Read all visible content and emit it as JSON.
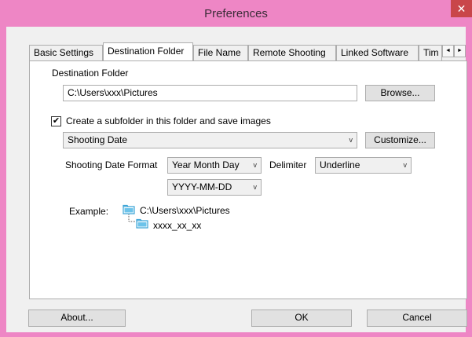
{
  "window": {
    "title": "Preferences",
    "close_icon": "close-icon",
    "close_glyph": "✕"
  },
  "tabs": [
    {
      "label": "Basic Settings",
      "active": false
    },
    {
      "label": "Destination Folder",
      "active": true
    },
    {
      "label": "File Name",
      "active": false
    },
    {
      "label": "Remote Shooting",
      "active": false
    },
    {
      "label": "Linked Software",
      "active": false
    },
    {
      "label": "Tim",
      "active": false
    }
  ],
  "tab_scroll": {
    "left": "◄",
    "right": "►"
  },
  "destination": {
    "section_label": "Destination Folder",
    "path_value": "C:\\Users\\xxx\\Pictures",
    "browse_label": "Browse..."
  },
  "subfolder": {
    "checkbox_label": "Create a subfolder in this folder and save images",
    "checked": true,
    "check_glyph": "✔",
    "mode_value": "Shooting Date",
    "customize_label": "Customize...",
    "date_format_label": "Shooting Date Format",
    "date_format_value": "Year Month Day",
    "delimiter_label": "Delimiter",
    "delimiter_value": "Underline",
    "pattern_value": "YYYY-MM-DD",
    "arrow_glyph": "v"
  },
  "example": {
    "label": "Example:",
    "root_path": "C:\\Users\\xxx\\Pictures",
    "subfolder_name": "xxxx_xx_xx"
  },
  "footer": {
    "about_label": "About...",
    "ok_label": "OK",
    "cancel_label": "Cancel"
  },
  "colors": {
    "titlebar": "#ee86c5",
    "close_button": "#c9464a",
    "folder_icon": "#3aa3d6"
  }
}
